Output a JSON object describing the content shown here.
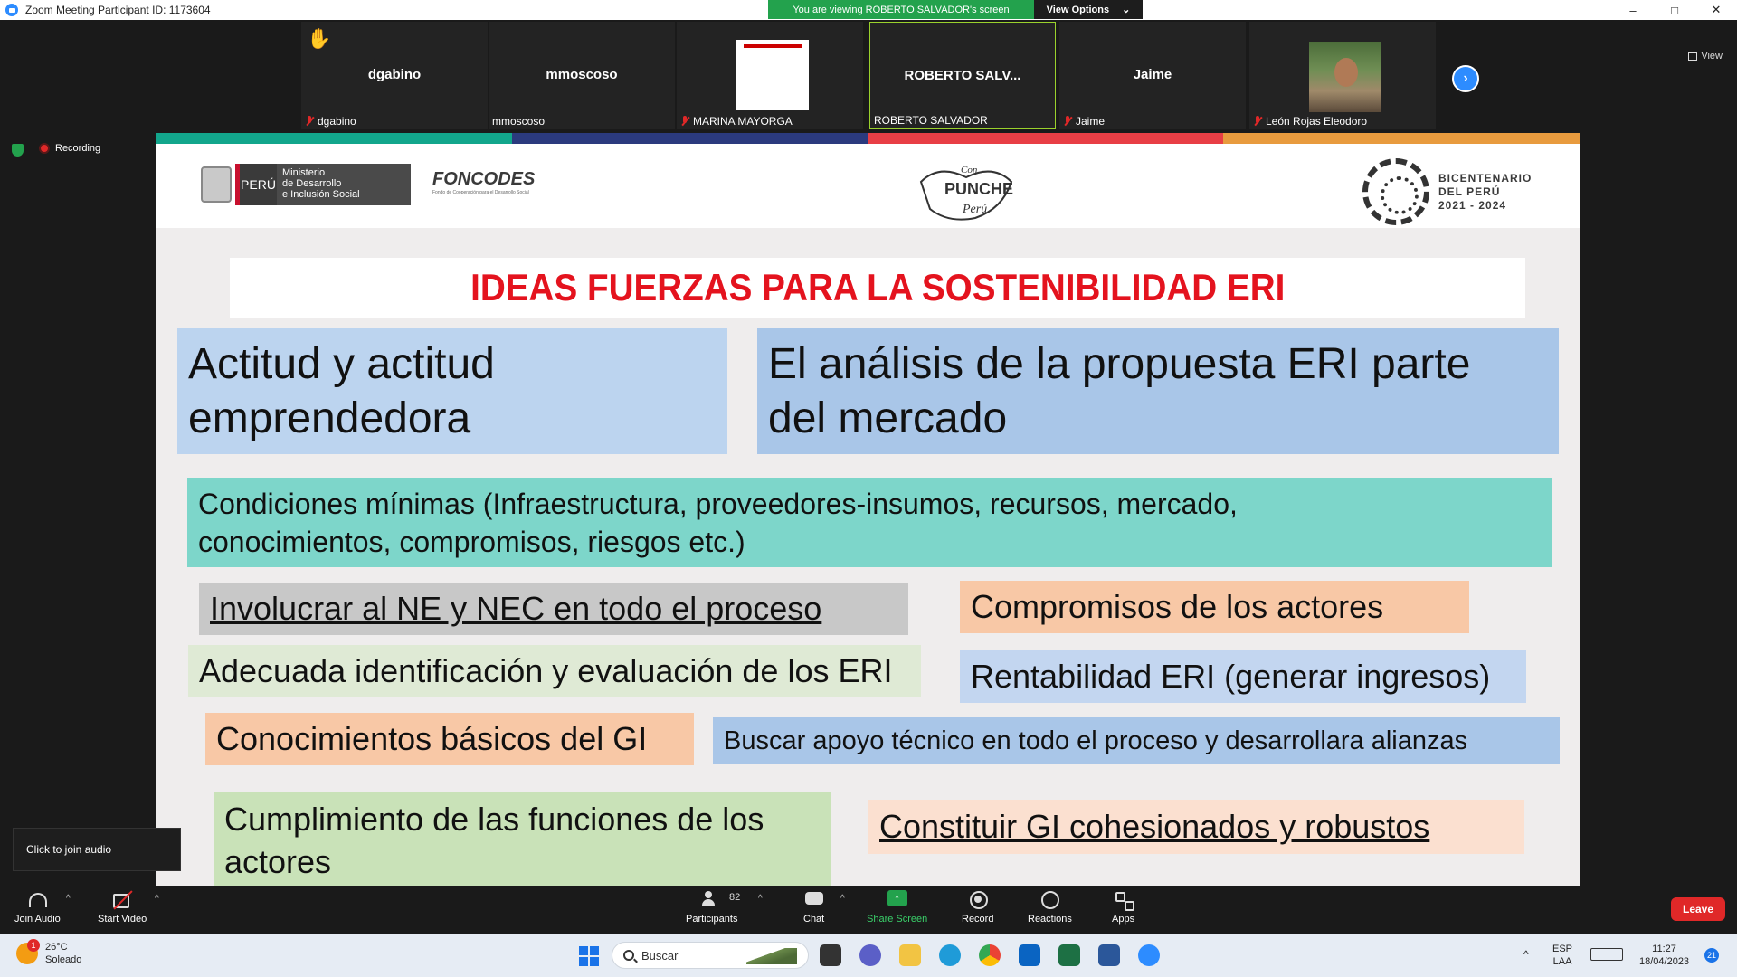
{
  "window": {
    "title": "Zoom Meeting Participant ID: 1173604",
    "controls": [
      "–",
      "□",
      "✕"
    ]
  },
  "banner": {
    "viewing": "You are viewing ROBERTO SALVADOR's screen",
    "view_options": "View Options",
    "chevron": "⌄"
  },
  "gallery": {
    "participants": [
      {
        "display": "dgabino",
        "label": "dgabino",
        "muted": true,
        "hand": "✋"
      },
      {
        "display": "mmoscoso",
        "label": "mmoscoso",
        "muted": false
      },
      {
        "display": "",
        "label": "MARINA MAYORGA",
        "muted": true
      },
      {
        "display": "ROBERTO SALV...",
        "label": "ROBERTO SALVADOR",
        "muted": false
      },
      {
        "display": "Jaime",
        "label": "Jaime",
        "muted": true
      },
      {
        "display": "",
        "label": "León Rojas Eleodoro",
        "muted": true
      }
    ],
    "next": "›",
    "view": "View"
  },
  "status": {
    "recording": "Recording"
  },
  "slide": {
    "colors": {
      "teal": "#12a68c",
      "navy": "#2b3a7e",
      "red": "#e83e45",
      "orange": "#e89b3e"
    },
    "ministry": {
      "peru": "PERÚ",
      "line1": "Ministerio",
      "line2": "de Desarrollo",
      "line3": "e Inclusión Social"
    },
    "foncodes": {
      "name": "FONCODES",
      "sub": "Fondo de Cooperación para el Desarrollo Social"
    },
    "punche": {
      "con": "Con",
      "punche": "PUNCHE",
      "peru": "Perú"
    },
    "bicentenario": {
      "line1": "BICENTENARIO",
      "line2": "DEL PERÚ",
      "line3": "2021 - 2024"
    },
    "title": "IDEAS FUERZAS PARA LA SOSTENIBILIDAD ERI",
    "cards": {
      "actitud": {
        "line1": "Actitud y actitud",
        "line2": "emprendedora"
      },
      "analisis": {
        "line1": "El análisis de la propuesta ERI parte",
        "line2": "del mercado"
      },
      "condiciones": {
        "line1": "Condiciones mínimas (Infraestructura, proveedores-insumos, recursos, mercado,",
        "line2": "conocimientos, compromisos, riesgos etc.)"
      },
      "involucrar": "Involucrar al NE y NEC en todo el proceso",
      "compromisos": "Compromisos de los actores",
      "adecuada": "Adecuada identificación y evaluación de los ERI",
      "rentabilidad": "Rentabilidad ERI (generar ingresos)",
      "conocimientos": "Conocimientos básicos del GI",
      "buscar": "Buscar apoyo técnico en todo el proceso y desarrollara alianzas",
      "cumplimiento": {
        "line1": "Cumplimiento de las funciones de los",
        "line2": "actores"
      },
      "constituir": "Constituir GI cohesionados y robustos"
    }
  },
  "tooltip": "Click to join audio",
  "toolbar": {
    "join_audio": "Join Audio",
    "start_video": "Start Video",
    "participants": "Participants",
    "participants_count": "82",
    "chat": "Chat",
    "share_screen": "Share Screen",
    "record": "Record",
    "reactions": "Reactions",
    "apps": "Apps",
    "leave": "Leave",
    "caret": "^"
  },
  "taskbar": {
    "weather_temp": "26°C",
    "weather_desc": "Soleado",
    "weather_badge": "1",
    "search_placeholder": "Buscar",
    "lang1": "ESP",
    "lang2": "LAA",
    "time": "11:27",
    "date": "18/04/2023",
    "notif": "21",
    "chevron": "^"
  }
}
